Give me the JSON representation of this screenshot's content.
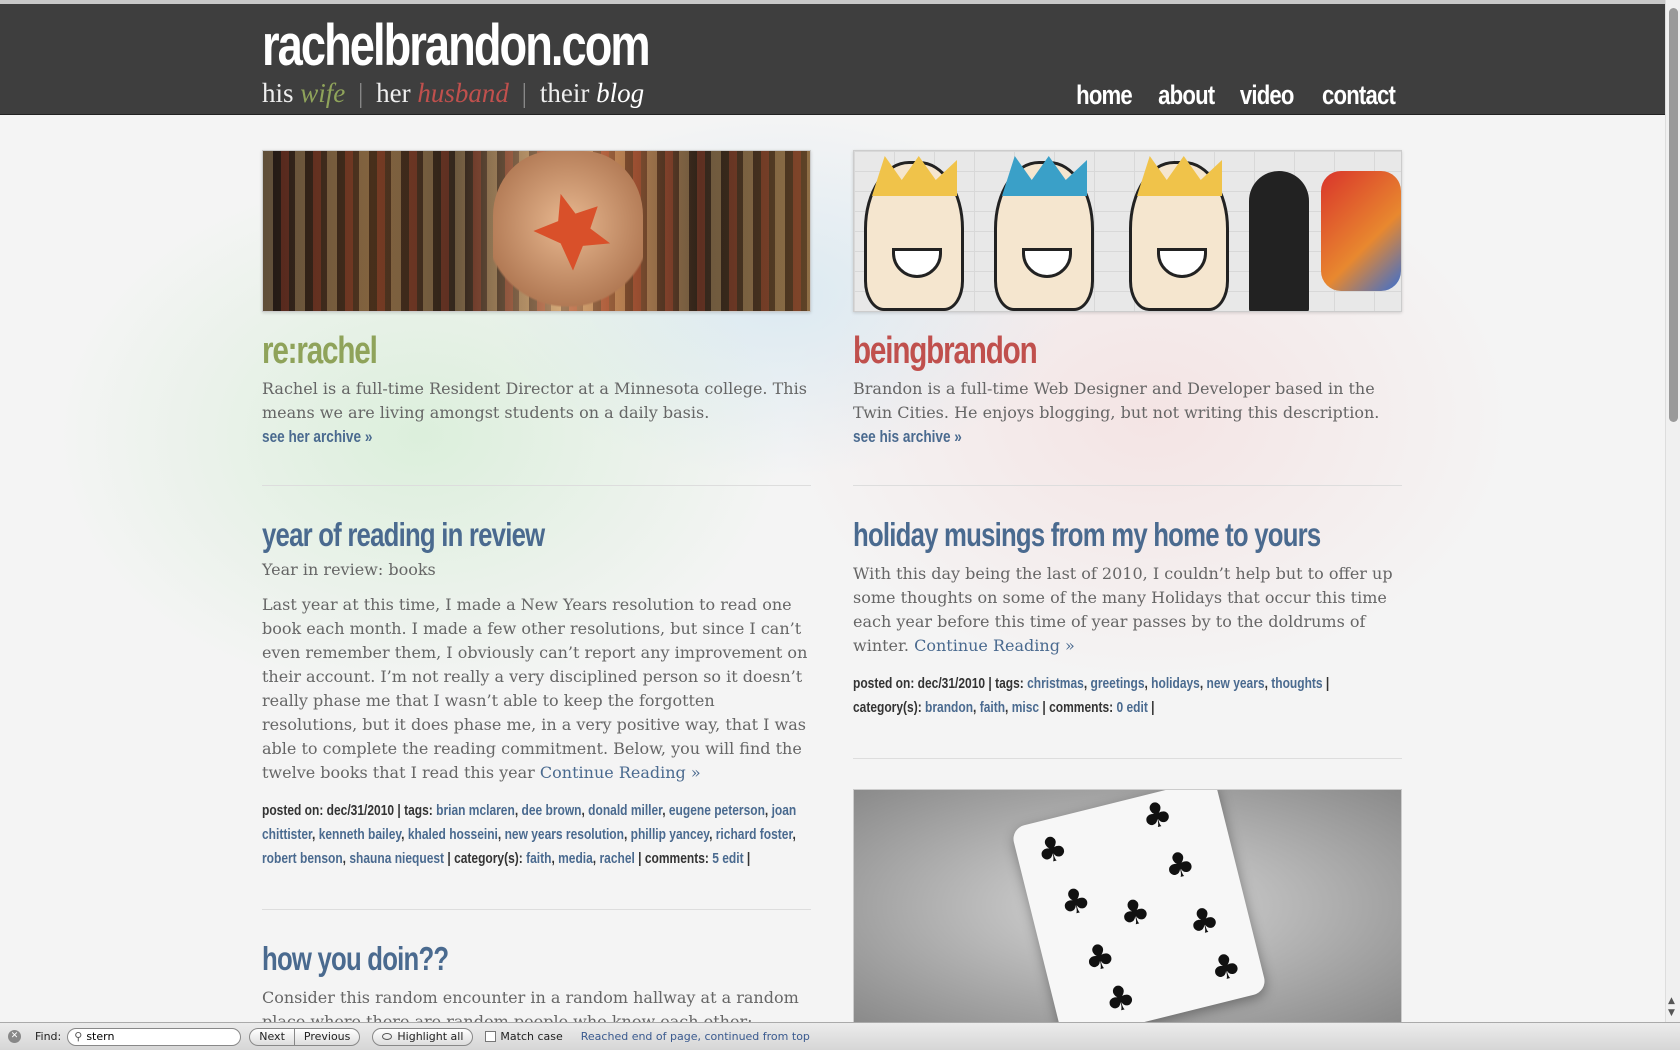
{
  "header": {
    "site_title": "rachelbrandon.com",
    "tagline": {
      "his": "his",
      "wife": "wife",
      "her": "her",
      "husband": "husband",
      "their": "their",
      "blog": "blog"
    },
    "nav": [
      "home",
      "about",
      "video",
      "contact"
    ]
  },
  "left": {
    "section_title": "re:rachel",
    "description": "Rachel is a full-time Resident Director at a Minnesota college. This means we are living amongst students on a daily basis.",
    "archive_link": "see her archive »",
    "posts": [
      {
        "title": "year of reading in review",
        "subtitle": "Year in review: books",
        "body": "Last year at this time, I made a New Years resolution to read one book each month. I made a few other resolutions, but since I can’t even remember them, I obviously can’t report any improvement on their account. I’m not really a very disciplined person so it doesn’t really phase me that I wasn’t able to keep the forgotten resolutions, but it does phase me, in a very positive way, that I was able to complete the reading commitment. Below, you will find the twelve books that I read this year",
        "continue": "Continue Reading »",
        "meta": {
          "posted_label": "posted on:",
          "date": "dec/31/2010",
          "tags_label": "tags:",
          "tags": [
            "brian mclaren",
            "dee brown",
            "donald miller",
            "eugene peterson",
            "joan chittister",
            "kenneth bailey",
            "khaled hosseini",
            "new years resolution",
            "phillip yancey",
            "richard foster",
            "robert benson",
            "shauna niequest"
          ],
          "category_label": "category(s):",
          "categories": [
            "faith",
            "media",
            "rachel"
          ],
          "comments_label": "comments:",
          "comments": "5",
          "edit": "edit"
        }
      },
      {
        "title": "how you doin??",
        "body": "Consider this random encounter in a random hallway at a random place where there are random people who know each other:"
      }
    ]
  },
  "right": {
    "section_title": "beingbrandon",
    "description": "Brandon is a full-time Web Designer and Developer based in the Twin Cities. He enjoys blogging, but not writing this description.",
    "archive_link": "see his archive »",
    "posts": [
      {
        "title": "holiday musings from my home to yours",
        "body": "With this day being the last of 2010, I couldn’t help but to offer up some thoughts on some of the many Holidays that occur this time each year before this time of year passes by to the doldrums of winter.",
        "continue": "Continue Reading »",
        "meta": {
          "posted_label": "posted on:",
          "date": "dec/31/2010",
          "tags_label": "tags:",
          "tags": [
            "christmas",
            "greetings",
            "holidays",
            "new years",
            "thoughts"
          ],
          "category_label": "category(s):",
          "categories": [
            "brandon",
            "faith",
            "misc"
          ],
          "comments_label": "comments:",
          "comments": "0",
          "edit": "edit"
        }
      }
    ]
  },
  "findbar": {
    "label": "Find:",
    "query": "stern",
    "next": "Next",
    "previous": "Previous",
    "highlight_all": "Highlight all",
    "match_case": "Match case",
    "status": "Reached end of page, continued from top"
  },
  "colors": {
    "header_bg": "#3e3e3e",
    "rachel_green": "#8fa35a",
    "brandon_red": "#c0504d",
    "link_blue": "#4a6a8f"
  }
}
